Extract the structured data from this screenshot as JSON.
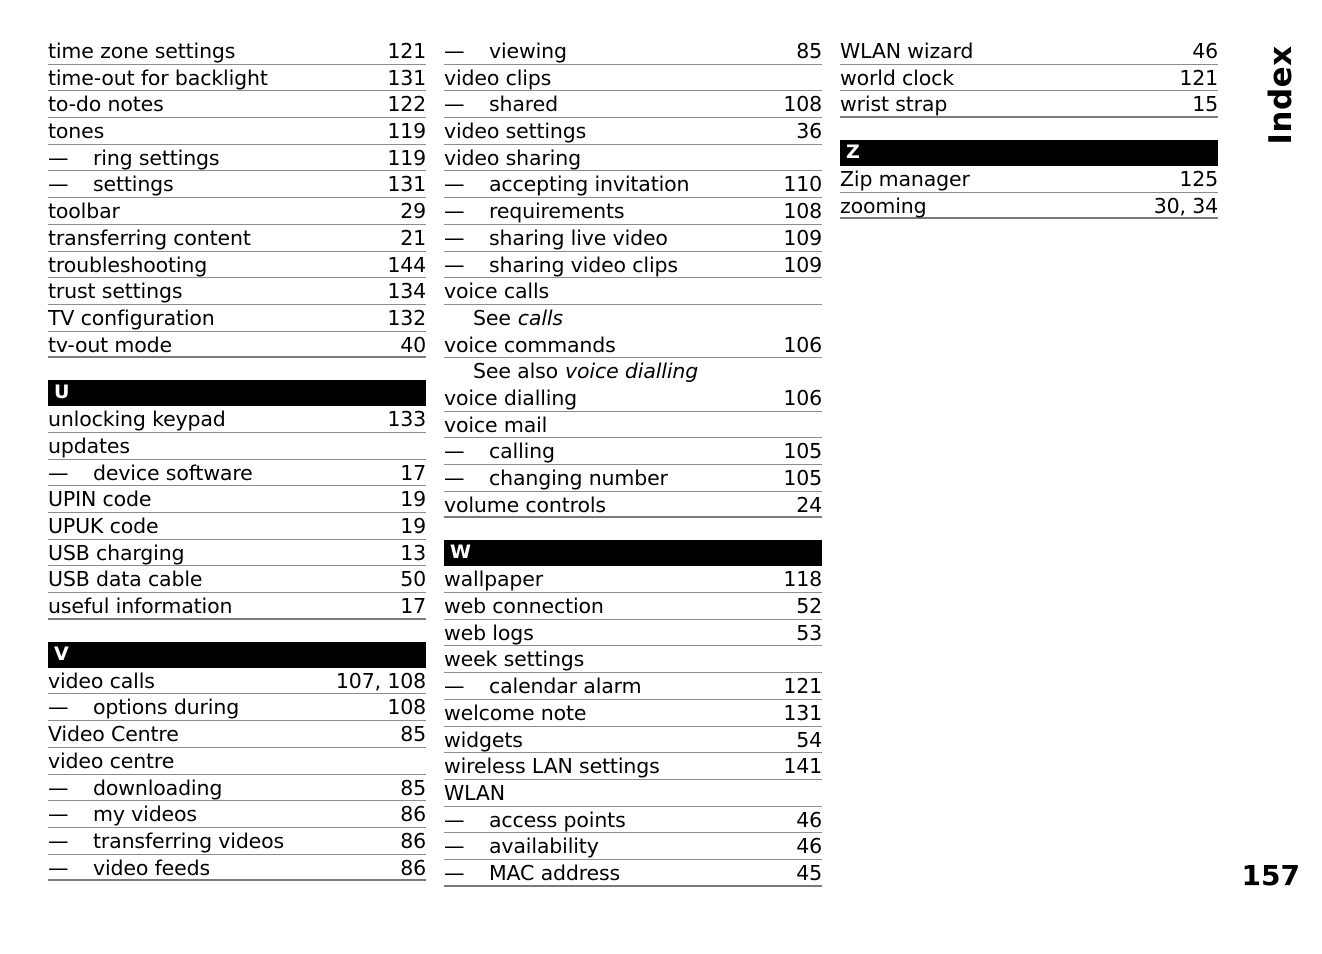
{
  "page": {
    "side_tab_label": "Index",
    "folio": "157"
  },
  "columns": [
    {
      "id": "column-1",
      "blocks": [
        {
          "type": "entries",
          "entries": [
            {
              "term": "time zone settings",
              "pages": "121"
            },
            {
              "term": "time-out for backlight",
              "pages": "131"
            },
            {
              "term": "to-do notes",
              "pages": "122"
            },
            {
              "term": "tones",
              "pages": "119"
            },
            {
              "dash": "—",
              "term": "ring settings",
              "pages": "119"
            },
            {
              "dash": "—",
              "term": "settings",
              "pages": "131"
            },
            {
              "term": "toolbar",
              "pages": "29"
            },
            {
              "term": "transferring content",
              "pages": "21"
            },
            {
              "term": "troubleshooting",
              "pages": "144"
            },
            {
              "term": "trust settings",
              "pages": "134"
            },
            {
              "term": "TV configuration",
              "pages": "132"
            },
            {
              "term": "tv-out mode",
              "pages": "40",
              "last": true
            }
          ]
        },
        {
          "type": "gap"
        },
        {
          "type": "letter",
          "letter": "U"
        },
        {
          "type": "entries",
          "entries": [
            {
              "term": "unlocking keypad",
              "pages": "133"
            },
            {
              "term": "updates",
              "pages": ""
            },
            {
              "dash": "—",
              "term": "device software",
              "pages": "17"
            },
            {
              "term": "UPIN code",
              "pages": "19"
            },
            {
              "term": "UPUK code",
              "pages": "19"
            },
            {
              "term": "USB charging",
              "pages": "13"
            },
            {
              "term": "USB data cable",
              "pages": "50"
            },
            {
              "term": "useful information",
              "pages": "17",
              "last": true
            }
          ]
        },
        {
          "type": "gap"
        },
        {
          "type": "letter",
          "letter": "V"
        },
        {
          "type": "entries",
          "entries": [
            {
              "term": "video calls",
              "pages": "107, 108"
            },
            {
              "dash": "—",
              "term": "options during",
              "pages": "108"
            },
            {
              "term": "Video Centre",
              "pages": "85"
            },
            {
              "term": "video centre",
              "pages": ""
            },
            {
              "dash": "—",
              "term": "downloading",
              "pages": "85"
            },
            {
              "dash": "—",
              "term": "my videos",
              "pages": "86"
            },
            {
              "dash": "—",
              "term": "transferring videos",
              "pages": "86"
            },
            {
              "dash": "—",
              "term": "video feeds",
              "pages": "86",
              "last": true
            }
          ]
        }
      ]
    },
    {
      "id": "column-2",
      "blocks": [
        {
          "type": "entries",
          "entries": [
            {
              "dash": "—",
              "term": "viewing",
              "pages": "85"
            },
            {
              "term": "video clips",
              "pages": ""
            },
            {
              "dash": "—",
              "term": "shared",
              "pages": "108"
            },
            {
              "term": "video settings",
              "pages": "36"
            },
            {
              "term": "video sharing",
              "pages": ""
            },
            {
              "dash": "—",
              "term": "accepting invitation",
              "pages": "110"
            },
            {
              "dash": "—",
              "term": "requirements",
              "pages": "108"
            },
            {
              "dash": "—",
              "term": "sharing live video",
              "pages": "109"
            },
            {
              "dash": "—",
              "term": "sharing video clips",
              "pages": "109"
            },
            {
              "term": "voice calls",
              "pages": ""
            },
            {
              "xref": true,
              "see_label": "See",
              "see_target": "calls"
            },
            {
              "term": "voice commands",
              "pages": "106"
            },
            {
              "xref": true,
              "see_label": "See also",
              "see_target": "voice dialling"
            },
            {
              "term": "voice dialling",
              "pages": "106"
            },
            {
              "term": "voice mail",
              "pages": ""
            },
            {
              "dash": "—",
              "term": "calling",
              "pages": "105"
            },
            {
              "dash": "—",
              "term": "changing number",
              "pages": "105"
            },
            {
              "term": "volume controls",
              "pages": "24",
              "last": true
            }
          ]
        },
        {
          "type": "gap"
        },
        {
          "type": "letter",
          "letter": "W"
        },
        {
          "type": "entries",
          "entries": [
            {
              "term": "wallpaper",
              "pages": "118"
            },
            {
              "term": "web connection",
              "pages": "52"
            },
            {
              "term": "web logs",
              "pages": "53"
            },
            {
              "term": "week settings",
              "pages": ""
            },
            {
              "dash": "—",
              "term": "calendar alarm",
              "pages": "121"
            },
            {
              "term": "welcome note",
              "pages": "131"
            },
            {
              "term": "widgets",
              "pages": "54"
            },
            {
              "term": "wireless LAN settings",
              "pages": "141"
            },
            {
              "term": "WLAN",
              "pages": ""
            },
            {
              "dash": "—",
              "term": "access points",
              "pages": "46"
            },
            {
              "dash": "—",
              "term": "availability",
              "pages": "46"
            },
            {
              "dash": "—",
              "term": "MAC address",
              "pages": "45",
              "last": true
            }
          ]
        }
      ]
    },
    {
      "id": "column-3",
      "blocks": [
        {
          "type": "entries",
          "entries": [
            {
              "term": "WLAN wizard",
              "pages": "46"
            },
            {
              "term": "world clock",
              "pages": "121"
            },
            {
              "term": "wrist strap",
              "pages": "15",
              "last": true
            }
          ]
        },
        {
          "type": "gap"
        },
        {
          "type": "letter",
          "letter": "Z"
        },
        {
          "type": "entries",
          "entries": [
            {
              "term": "Zip manager",
              "pages": "125"
            },
            {
              "term": "zooming",
              "pages": "30, 34",
              "last": true
            }
          ]
        }
      ]
    }
  ]
}
